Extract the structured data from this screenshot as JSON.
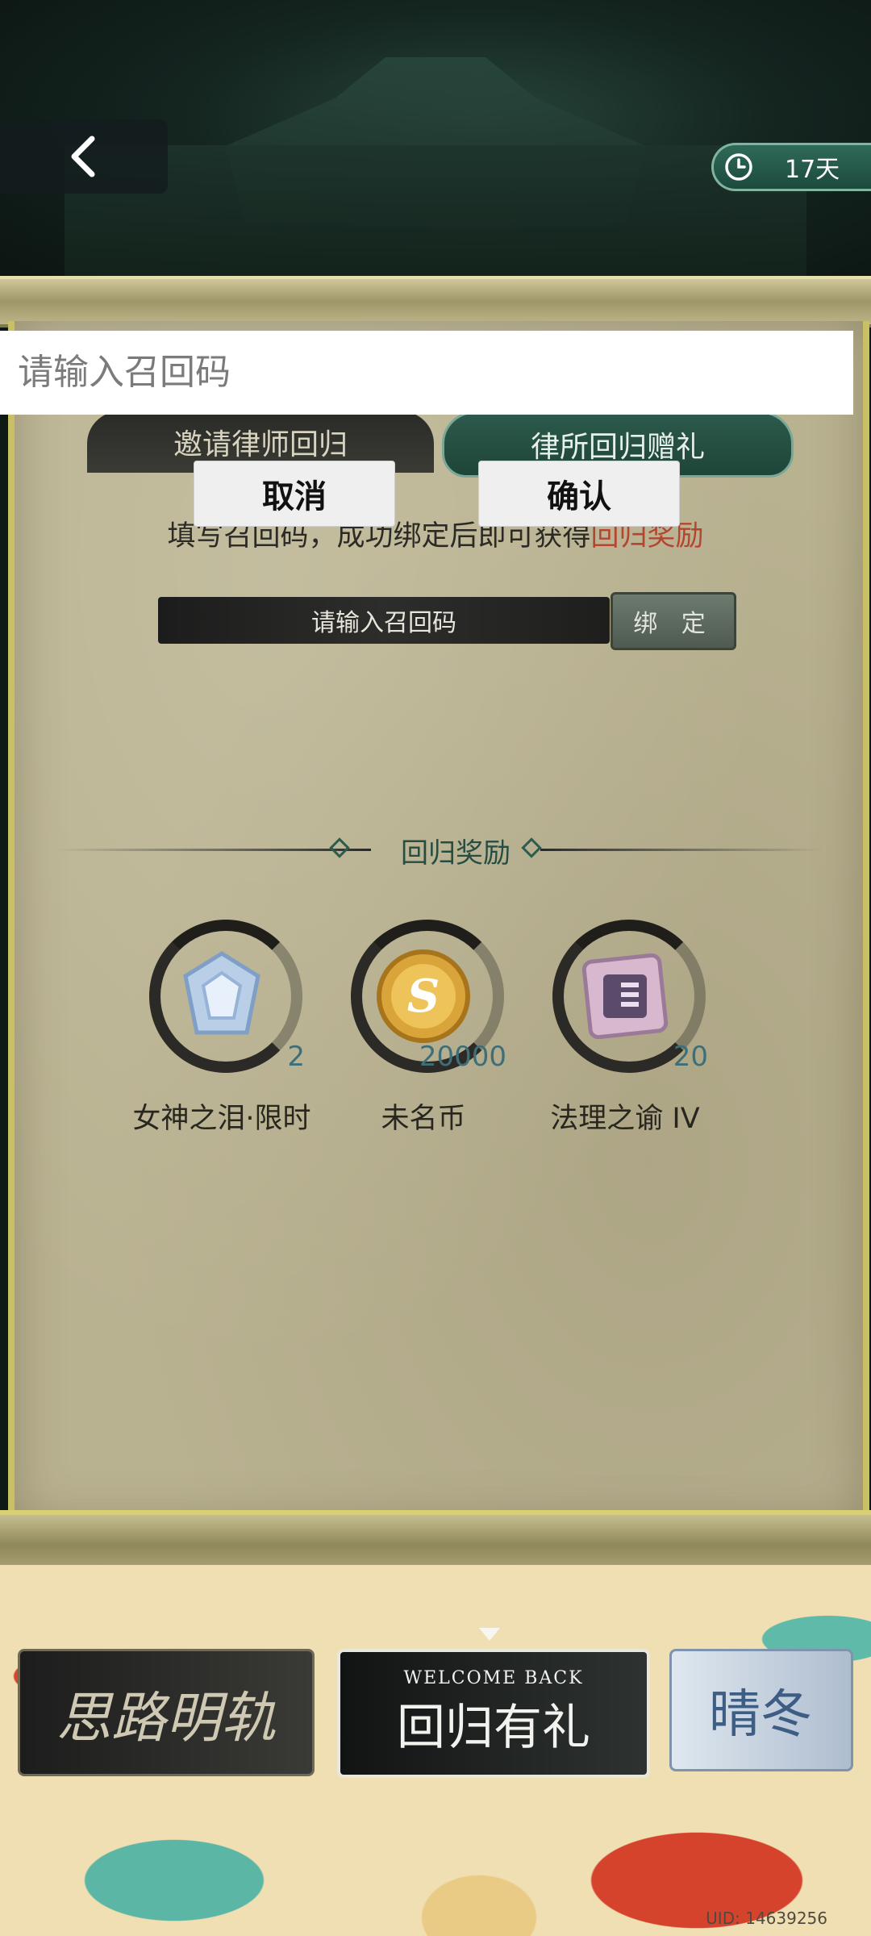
{
  "header": {
    "days_left": "17天"
  },
  "tabs": [
    {
      "label": "邀请律师回归"
    },
    {
      "label": "律所回归赠礼"
    }
  ],
  "bind": {
    "desc_prefix": "填写召回码，成功绑定后即可获得",
    "desc_highlight": "回归奖励",
    "code_placeholder": "请输入召回码",
    "bind_label": "绑 定"
  },
  "rewards_section": {
    "title": "回归奖励",
    "items": [
      {
        "name": "女神之泪·限时",
        "quantity": "2",
        "icon": "crystal-icon"
      },
      {
        "name": "未名币",
        "quantity": "20000",
        "icon": "coin-icon"
      },
      {
        "name": "法理之谕 IV",
        "quantity": "20",
        "icon": "book-icon"
      }
    ]
  },
  "banners": [
    {
      "title": "思路明轨"
    },
    {
      "subtitle": "WELCOME BACK",
      "title": "回归有礼"
    },
    {
      "title": "晴冬"
    }
  ],
  "uid": "UID: 14639256",
  "dialog": {
    "input_placeholder": "请输入召回码",
    "cancel_label": "取消",
    "confirm_label": "确认"
  },
  "colors": {
    "accent_green": "#2c5a4c",
    "highlight_red": "#b4452f",
    "parchment": "#b9b291"
  }
}
